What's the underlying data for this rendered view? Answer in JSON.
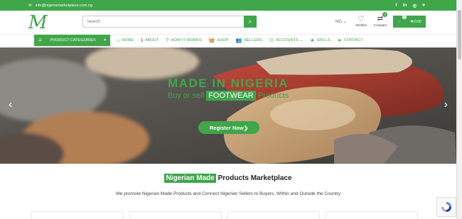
{
  "topbar": {
    "email": "info@nigeriamarketplace.com.ng",
    "socials": [
      "f",
      "in",
      "◎",
      "♥"
    ]
  },
  "header": {
    "logo_text": "M",
    "search_placeholder": "Search",
    "flag_label": "NG",
    "wishlist_label": "Wishlist",
    "compare_label": "Compare",
    "wishlist_count": "0",
    "compare_count": "0",
    "cart_count": "0",
    "cart_total": "₦ 0.00"
  },
  "nav": {
    "categories_label": "PRODUCT CATEGORIES",
    "items": [
      {
        "icon": "⌂",
        "label": "HOME"
      },
      {
        "icon": "ℹ",
        "label": "ABOUT"
      },
      {
        "icon": "?",
        "label": "HOW IT WORKS"
      },
      {
        "icon": "🧺",
        "label": "SHOP"
      },
      {
        "icon": "👥",
        "label": "SELLERS"
      },
      {
        "icon": "☷",
        "label": "ACCOUNTS ⌄"
      },
      {
        "icon": "★",
        "label": "SKILLS"
      },
      {
        "icon": "➤",
        "label": "CONTACT"
      }
    ]
  },
  "hero": {
    "title": "MADE IN NIGERIA",
    "sub_prefix": "Buy or sell",
    "sub_highlight": "FOOTWEAR",
    "sub_suffix": "Products",
    "cta": "Register Now",
    "arrow_left": "‹",
    "arrow_right": "›"
  },
  "section": {
    "heading_highlight": "Nigerian Made",
    "heading_rest": "Products Marketplace",
    "description": "We promote Nigerian Made Products and Connect Nigerian Sellers to Buyers, Within and Outside the Country"
  },
  "colors": {
    "brand": "#3fa64a",
    "text": "#333333"
  }
}
